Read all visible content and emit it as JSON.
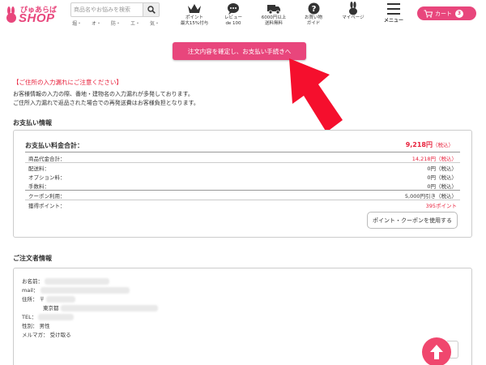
{
  "header": {
    "logo_top": "ぴゅあらば",
    "logo_shop": "SHOP",
    "search_placeholder": "商品名やお悩みを検索",
    "search_tags": [
      "堀・",
      "オ・",
      "防・",
      "エ・",
      "気・"
    ],
    "nav": [
      {
        "icon": "crown-icon",
        "label1": "ポイント",
        "label2": "最大15%付与"
      },
      {
        "icon": "speech-bubble-icon",
        "label1": "レビュー",
        "label2": "de 100"
      },
      {
        "icon": "truck-icon",
        "label1": "6000円以上",
        "label2": "送料無料"
      },
      {
        "icon": "question-icon",
        "label1": "お買い物",
        "label2": "ガイド"
      },
      {
        "icon": "rabbit-icon",
        "label1": "マイページ",
        "label2": ""
      }
    ],
    "menu_label": "メニュー",
    "cart_label": "カート",
    "cart_count": "3"
  },
  "confirm_button": "注文内容を確定し、お支払い手続きへ",
  "notice": {
    "title": "【ご住所の入力漏れにご注意ください】",
    "line1": "お客様情報の入力の際、番地・建物名の入力漏れが多発しております。",
    "line2": "ご住所入力漏れで返品された場合での再発送費はお客様負担となります。"
  },
  "payment": {
    "section_title": "お支払い情報",
    "total_label": "お支払い料金合計：",
    "total_value": "9,218円",
    "total_tax": "（税込）",
    "rows": [
      {
        "label": "商品代金合計：",
        "value": "14,218円（税込）",
        "red": true
      },
      {
        "label": "配送料：",
        "value": "0円（税込）",
        "red": false
      },
      {
        "label": "オプション料：",
        "value": "0円（税込）",
        "red": false
      },
      {
        "label": "手数料：",
        "value": "0円（税込）",
        "red": false
      },
      {
        "label": "クーポン利用：",
        "value": "5,000円引き（税込）",
        "red": false
      },
      {
        "label": "獲得ポイント：",
        "value": "395ポイント",
        "red": true
      }
    ],
    "coupon_button": "ポイント・クーポンを使用する"
  },
  "orderer": {
    "section_title": "ご注文者情報",
    "name_label": "お名前：",
    "mail_label": "mail：",
    "address_label": "住所：",
    "address_prefix": "〒",
    "address_city": "東京都",
    "tel_label": "TEL：",
    "gender_label": "性別：",
    "gender_value": "男性",
    "magazine_label": "メルマガ：",
    "magazine_value": "受け取る"
  },
  "colors": {
    "brand_pink": "#e8467c",
    "alert_red": "#e8213c",
    "arrow_red": "#f50f2d"
  }
}
